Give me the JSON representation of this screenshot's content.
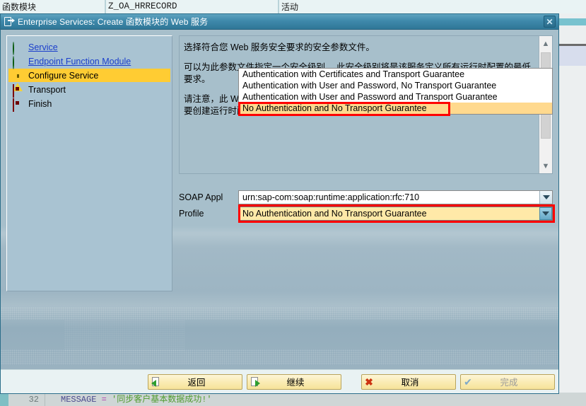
{
  "background": {
    "toolbar": {
      "label_left": "函数模块",
      "object_name": "Z_OA_HRRECORD",
      "status": "活动"
    },
    "code_line": {
      "number": "32",
      "prefix": "MESSAGE",
      "operator": "=",
      "string": "'同步客户基本数据成功!'"
    }
  },
  "dialog": {
    "title": "Enterprise Services: Create 函数模块的 Web 服务",
    "title_icon": "window-document-icon",
    "close_icon": "close-icon",
    "nav": {
      "items": [
        {
          "label": "Service",
          "status": "done",
          "link": true
        },
        {
          "label": "Endpoint Function Module",
          "status": "done",
          "link": true
        },
        {
          "label": "Configure Service",
          "status": "current",
          "link": false
        },
        {
          "label": "Transport",
          "status": "pending",
          "link": false
        },
        {
          "label": "Finish",
          "status": "pending",
          "link": false
        }
      ]
    },
    "description": {
      "paragraphs": [
        "选择符合您 Web 服务安全要求的安全参数文件。",
        "可以为此参数文件指定一个安全级别。 此安全级别将是该服务定义所有运行时配置的最低要求。",
        "请注意，此 Web 服务不具有任何运行时配置，因此无法部署。\n要创建运行时配置，请使用 SAP Netweaver Administrator。"
      ],
      "scrollbar": {
        "up_icon": "chevron-up-icon",
        "down_icon": "chevron-down-icon"
      }
    },
    "form": {
      "soap_appl": {
        "label": "SOAP Appl",
        "value": "urn:sap-com:soap:runtime:application:rfc:710"
      },
      "profile": {
        "label": "Profile",
        "value": "No Authentication and No Transport Guarantee",
        "expanded": true,
        "options": [
          "Authentication with Certificates and Transport Guarantee",
          "Authentication with User and Password, No Transport Guarantee",
          "Authentication with User and Password and Transport Guarantee",
          "No Authentication and No Transport Guarantee"
        ],
        "selected_index": 3
      }
    },
    "footer": {
      "buttons": [
        {
          "label": "返回",
          "icon": "back-document-icon",
          "disabled": false
        },
        {
          "label": "继续",
          "icon": "forward-document-icon",
          "disabled": false
        },
        {
          "label": "取消",
          "icon": "cancel-x-icon",
          "disabled": false
        },
        {
          "label": "完成",
          "icon": "check-icon",
          "disabled": true
        }
      ]
    }
  },
  "annotations": {
    "accent_color": "#ff0000",
    "highlight_color": "#ffcc33"
  }
}
